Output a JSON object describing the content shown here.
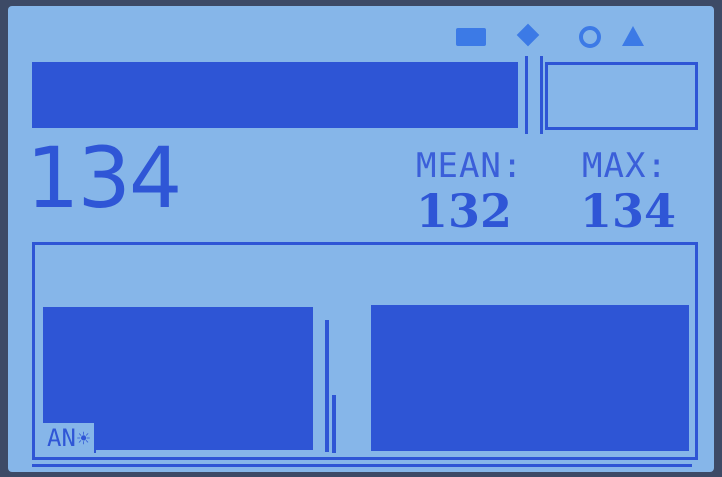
{
  "status_icons": [
    "battery-icon",
    "diamond-icon",
    "ring-icon",
    "triangle-icon"
  ],
  "level_bar": {
    "fill_fraction": 0.73,
    "marker_fraction": 0.74
  },
  "readout": {
    "current": "134",
    "mean_label": "MEAN:",
    "mean_value": "132",
    "max_label": "MAX:",
    "max_value": "134"
  },
  "lower_panel": {
    "mode_label": "AN",
    "mode_icon": "sun-icon",
    "channel_a_level": 0.68,
    "channel_b_level": 0.72
  },
  "colors": {
    "screen": "#86b6e9",
    "ink": "#2e55d5",
    "status_icons": "#3c7ae6"
  }
}
